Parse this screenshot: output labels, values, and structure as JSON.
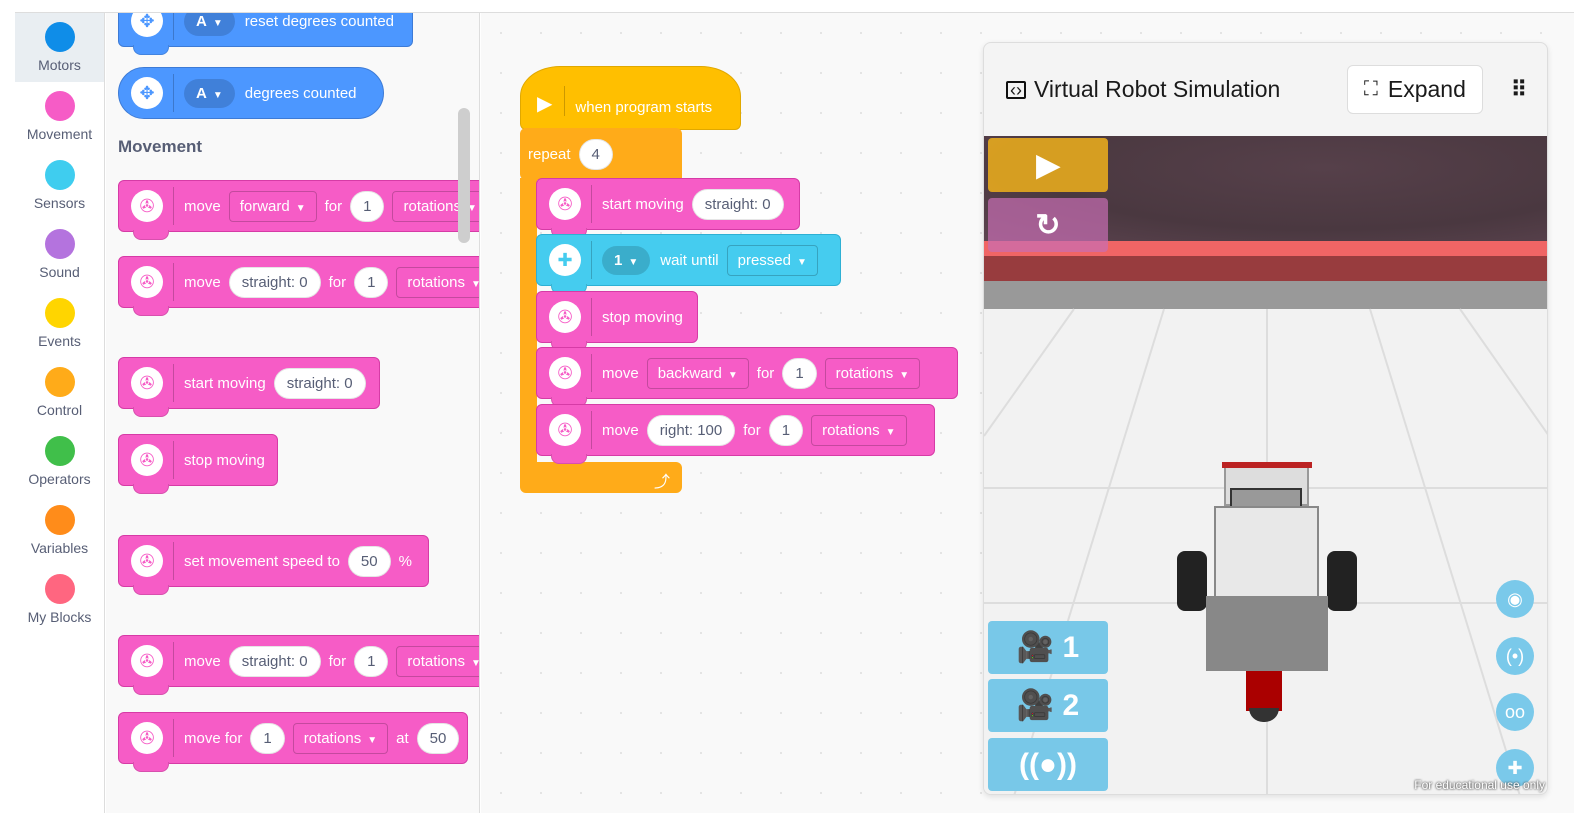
{
  "categories": [
    {
      "label": "Motors",
      "color": "#0f8de8",
      "selected": true
    },
    {
      "label": "Movement",
      "color": "#f65cc6"
    },
    {
      "label": "Sensors",
      "color": "#3fcdef"
    },
    {
      "label": "Sound",
      "color": "#b473de"
    },
    {
      "label": "Events",
      "color": "#ffd500"
    },
    {
      "label": "Control",
      "color": "#ffab19"
    },
    {
      "label": "Operators",
      "color": "#40bf4a"
    },
    {
      "label": "Variables",
      "color": "#ff8c1a"
    },
    {
      "label": "My Blocks",
      "color": "#ff6680"
    }
  ],
  "flyout": {
    "heading": "Movement",
    "blocks": [
      {
        "color": "blue",
        "icon": "motor-icon",
        "items": [
          {
            "t": "pill",
            "v": "A"
          },
          {
            "t": "text",
            "v": "reset degrees counted"
          }
        ]
      },
      {
        "color": "blue",
        "icon": "motor-icon",
        "reporter": true,
        "items": [
          {
            "t": "pill",
            "v": "A"
          },
          {
            "t": "text",
            "v": "degrees counted"
          }
        ]
      },
      {
        "color": "pink",
        "icon": "movement-icon",
        "items": [
          {
            "t": "text",
            "v": "move"
          },
          {
            "t": "dd",
            "v": "forward"
          },
          {
            "t": "text",
            "v": "for"
          },
          {
            "t": "rnd",
            "v": "1"
          },
          {
            "t": "dd",
            "v": "rotations"
          }
        ]
      },
      {
        "color": "pink",
        "icon": "movement-icon",
        "items": [
          {
            "t": "text",
            "v": "move"
          },
          {
            "t": "rnd",
            "v": "straight: 0"
          },
          {
            "t": "text",
            "v": "for"
          },
          {
            "t": "rnd",
            "v": "1"
          },
          {
            "t": "dd",
            "v": "rotations"
          }
        ]
      },
      {
        "color": "pink",
        "icon": "movement-icon",
        "items": [
          {
            "t": "text",
            "v": "start moving"
          },
          {
            "t": "rnd",
            "v": "straight: 0"
          }
        ]
      },
      {
        "color": "pink",
        "icon": "movement-icon",
        "items": [
          {
            "t": "text",
            "v": "stop moving"
          }
        ]
      },
      {
        "color": "pink",
        "icon": "movement-icon",
        "items": [
          {
            "t": "text",
            "v": "set movement speed to"
          },
          {
            "t": "rnd",
            "v": "50"
          },
          {
            "t": "text",
            "v": "%"
          }
        ]
      },
      {
        "color": "pink",
        "icon": "movement-icon",
        "items": [
          {
            "t": "text",
            "v": "move"
          },
          {
            "t": "rnd",
            "v": "straight: 0"
          },
          {
            "t": "text",
            "v": "for"
          },
          {
            "t": "rnd",
            "v": "1"
          },
          {
            "t": "dd",
            "v": "rotations"
          }
        ]
      },
      {
        "color": "pink",
        "icon": "movement-icon",
        "items": [
          {
            "t": "text",
            "v": "move for"
          },
          {
            "t": "rnd",
            "v": "1"
          },
          {
            "t": "dd",
            "v": "rotations"
          },
          {
            "t": "text",
            "v": "at"
          },
          {
            "t": "rnd",
            "v": "50"
          }
        ]
      }
    ]
  },
  "workspace": {
    "hat": "when program starts",
    "repeat": {
      "label": "repeat",
      "count": "4"
    },
    "blocks": [
      {
        "color": "pink",
        "icon": "movement-icon",
        "items": [
          {
            "t": "text",
            "v": "start moving"
          },
          {
            "t": "rnd",
            "v": "straight: 0"
          }
        ]
      },
      {
        "color": "cyan",
        "icon": "brick-buttons-icon",
        "items": [
          {
            "t": "pill",
            "v": "1"
          },
          {
            "t": "text",
            "v": "wait until"
          },
          {
            "t": "dd",
            "v": "pressed"
          }
        ]
      },
      {
        "color": "pink",
        "icon": "movement-icon",
        "items": [
          {
            "t": "text",
            "v": "stop moving"
          }
        ]
      },
      {
        "color": "pink",
        "icon": "movement-icon",
        "items": [
          {
            "t": "text",
            "v": "move"
          },
          {
            "t": "dd",
            "v": "backward"
          },
          {
            "t": "text",
            "v": "for"
          },
          {
            "t": "rnd",
            "v": "1"
          },
          {
            "t": "dd",
            "v": "rotations"
          }
        ]
      },
      {
        "color": "pink",
        "icon": "movement-icon",
        "items": [
          {
            "t": "text",
            "v": "move"
          },
          {
            "t": "rnd",
            "v": "right: 100"
          },
          {
            "t": "text",
            "v": "for"
          },
          {
            "t": "rnd",
            "v": "1"
          },
          {
            "t": "dd",
            "v": "rotations"
          }
        ]
      }
    ]
  },
  "sim": {
    "title": "Virtual Robot Simulation",
    "expand": "Expand",
    "camera1": "1",
    "camera2": "2",
    "watermark": "For educational use only"
  }
}
